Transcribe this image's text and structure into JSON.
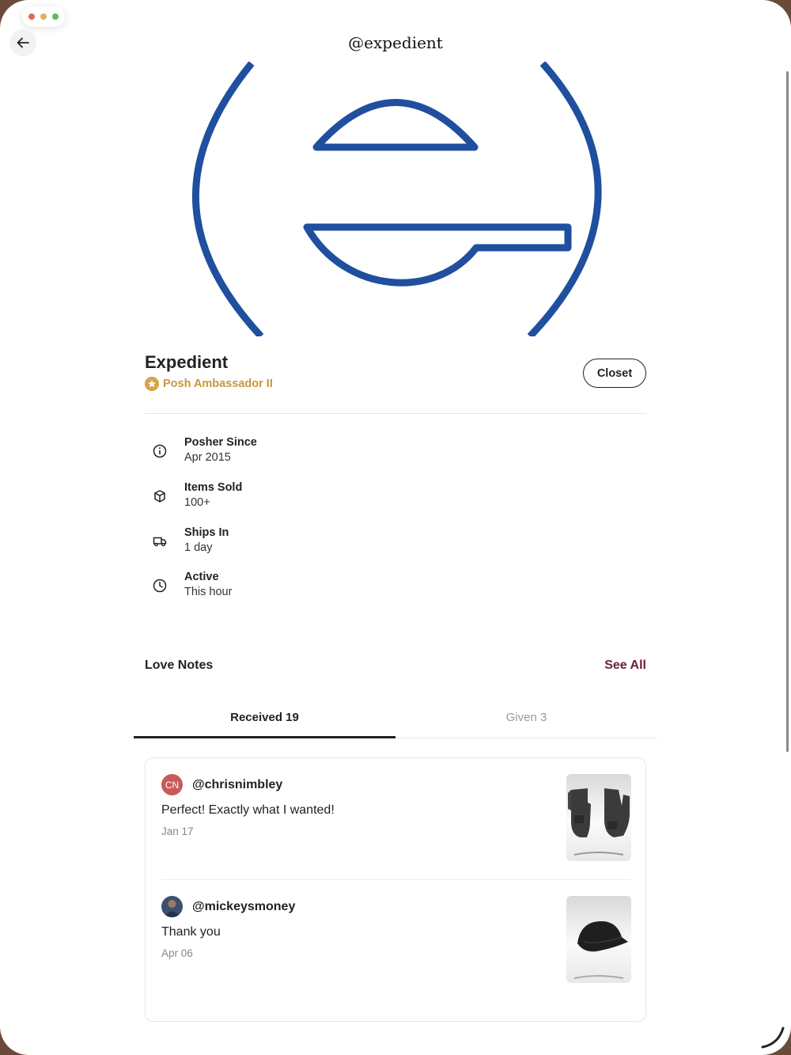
{
  "window": {
    "traffic_lights": [
      "#e0685e",
      "#e0b15a",
      "#63b85a"
    ]
  },
  "header": {
    "title": "@expedient",
    "back_icon": "arrow-left-icon"
  },
  "profile": {
    "banner_logo": "expedient-e-logo",
    "brand_color": "#1f4f9e",
    "name": "Expedient",
    "badge": "Posh Ambassador II",
    "badge_color": "#c8963e",
    "closet_button": "Closet"
  },
  "stats": [
    {
      "icon": "info-icon",
      "label": "Posher Since",
      "value": "Apr 2015"
    },
    {
      "icon": "box-icon",
      "label": "Items Sold",
      "value": "100+"
    },
    {
      "icon": "truck-icon",
      "label": "Ships In",
      "value": "1 day"
    },
    {
      "icon": "clock-icon",
      "label": "Active",
      "value": "This hour"
    }
  ],
  "love_notes": {
    "title": "Love Notes",
    "see_all": "See All",
    "tabs": [
      {
        "label": "Received 19",
        "active": true
      },
      {
        "label": "Given 3",
        "active": false
      }
    ],
    "notes": [
      {
        "avatar_initials": "CN",
        "avatar_color": "#c95a5a",
        "username": "@chrisnimbley",
        "text": "Perfect! Exactly what I wanted!",
        "date": "Jan 17",
        "thumb": "gloves-image"
      },
      {
        "avatar_initials": "",
        "avatar_color": "#3d4f6e",
        "username": "@mickeysmoney",
        "text": "Thank you",
        "date": "Apr 06",
        "thumb": "cap-image"
      }
    ]
  }
}
